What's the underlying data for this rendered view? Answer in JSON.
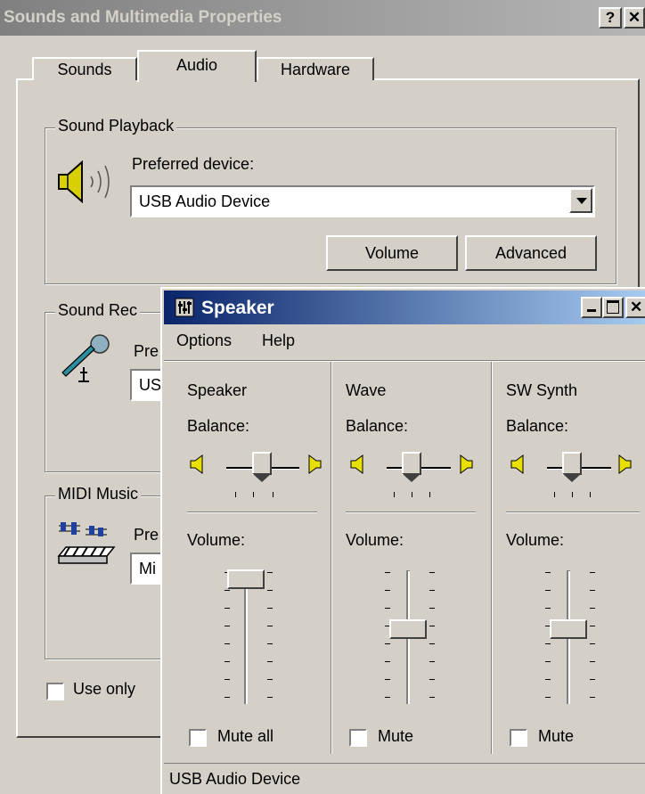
{
  "dialog": {
    "title": "Sounds and Multimedia Properties",
    "help_button": "?",
    "close_button": "✕",
    "tabs": [
      {
        "label": "Sounds"
      },
      {
        "label": "Audio",
        "selected": true
      },
      {
        "label": "Hardware"
      }
    ],
    "playback": {
      "group_label": "Sound Playback",
      "preferred_label": "Preferred device:",
      "device": "USB Audio Device",
      "volume_button": "Volume",
      "advanced_button": "Advanced"
    },
    "recording": {
      "group_label": "Sound Rec",
      "preferred_label": "Pre",
      "device": "US"
    },
    "midi": {
      "group_label": "MIDI Music",
      "preferred_label": "Pre",
      "device": "Mi"
    },
    "use_only_label": "Use only",
    "use_only_checked": false
  },
  "speaker": {
    "title": "Speaker",
    "menu": [
      "Options",
      "Help"
    ],
    "columns": [
      {
        "name": "Speaker",
        "balance_label": "Balance:",
        "volume_label": "Volume:",
        "volume": 0.95,
        "mute_label": "Mute all",
        "muted": false
      },
      {
        "name": "Wave",
        "balance_label": "Balance:",
        "volume_label": "Volume:",
        "volume": 0.55,
        "mute_label": "Mute",
        "muted": false
      },
      {
        "name": "SW Synth",
        "balance_label": "Balance:",
        "volume_label": "Volume:",
        "volume": 0.55,
        "mute_label": "Mute",
        "muted": false
      }
    ],
    "status": "USB Audio Device"
  }
}
